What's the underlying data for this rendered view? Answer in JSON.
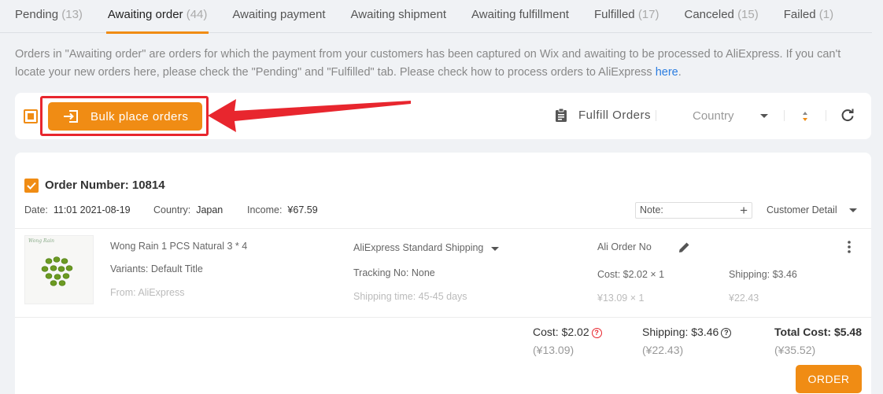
{
  "tabs": [
    {
      "label": "Pending",
      "count": "(13)"
    },
    {
      "label": "Awaiting order",
      "count": "(44)"
    },
    {
      "label": "Awaiting payment",
      "count": ""
    },
    {
      "label": "Awaiting shipment",
      "count": ""
    },
    {
      "label": "Awaiting fulfillment",
      "count": ""
    },
    {
      "label": "Fulfilled",
      "count": "(17)"
    },
    {
      "label": "Canceled",
      "count": "(15)"
    },
    {
      "label": "Failed",
      "count": "(1)"
    }
  ],
  "info": {
    "text": "Orders in \"Awaiting order\" are orders for which the payment from your customers has been captured on Wix and awaiting to be processed to AliExpress. If you can't locate your new orders here, please check the \"Pending\" and \"Fulfilled\" tab. Please check how to process orders to AliExpress ",
    "link": "here",
    "end": "."
  },
  "toolbar": {
    "bulk_label": "Bulk place orders",
    "fulfill_label": "Fulfill Orders",
    "country_placeholder": "Country"
  },
  "order": {
    "title": "Order Number: 10814",
    "date_label": "Date:",
    "date_value": "11:01 2021-08-19",
    "country_label": "Country:",
    "country_value": "Japan",
    "income_label": "Income:",
    "income_value": "¥67.59",
    "note_placeholder": "Note:",
    "customer_detail": "Customer Detail",
    "thumb_brand": "Wong Rain",
    "product": {
      "name": "Wong Rain 1 PCS Natural 3 * 4",
      "variants": "Variants: Default Title",
      "from": "From: AliExpress",
      "shipping_method": "AliExpress Standard Shipping",
      "tracking": "Tracking No: None",
      "shipping_time": "Shipping time: 45-45 days",
      "ali_order_no": "Ali Order No",
      "cost": "Cost: $2.02 × 1",
      "cost_cny": "¥13.09 × 1",
      "shipping": "Shipping: $3.46",
      "shipping_cny": "¥22.43"
    },
    "summary": {
      "cost": "Cost: $2.02",
      "cost_cny": "(¥13.09)",
      "shipping": "Shipping: $3.46",
      "shipping_cny": "(¥22.43)",
      "total": "Total Cost: $5.48",
      "total_cny": "(¥35.52)"
    },
    "order_button": "ORDER"
  },
  "colors": {
    "accent": "#f08c14",
    "highlight_red": "#e8262e",
    "link": "#2b7de0",
    "background": "#f0f2f5"
  }
}
